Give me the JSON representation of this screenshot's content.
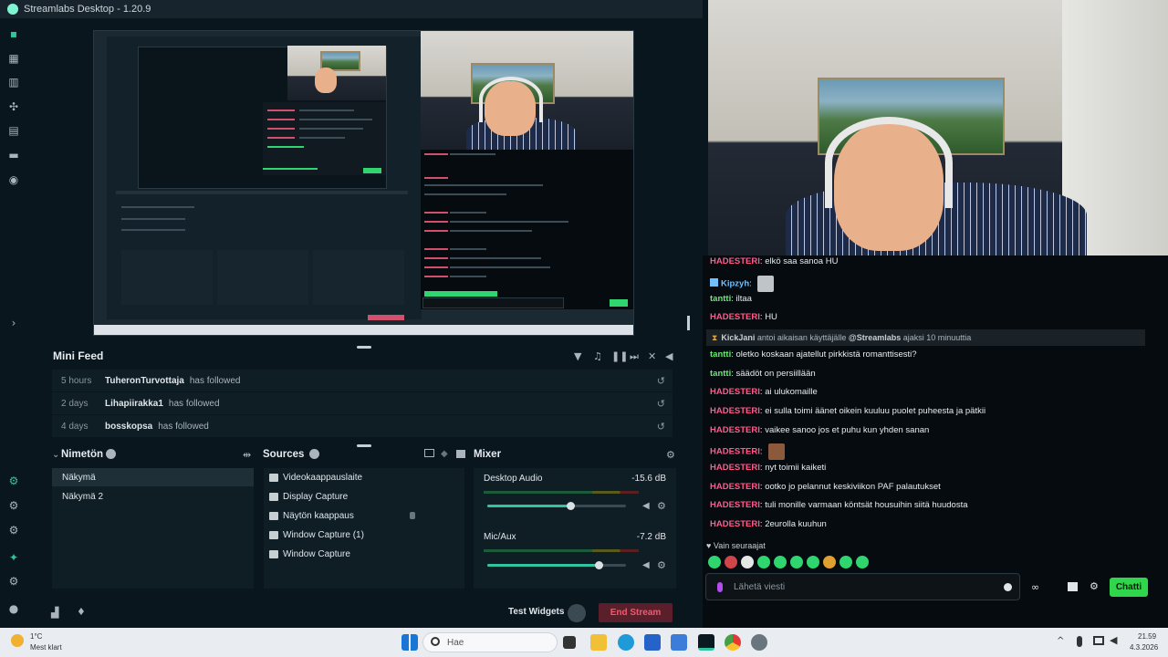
{
  "app": {
    "title": "Streamlabs Desktop - 1.20.9"
  },
  "minifeed": {
    "title": "Mini Feed",
    "items": [
      {
        "time": "5 hours",
        "name": "TuheronTurvottaja",
        "action": "has followed"
      },
      {
        "time": "2 days",
        "name": "Lihapiirakka1",
        "action": "has followed"
      },
      {
        "time": "4 days",
        "name": "bosskopsa",
        "action": "has followed"
      }
    ]
  },
  "scenes": {
    "title": "Nimetön",
    "items": [
      "Näkymä",
      "Näkymä 2"
    ]
  },
  "sources": {
    "title": "Sources",
    "items": [
      "Videokaappauslaite",
      "Display Capture",
      "Näytön kaappaus",
      "Window Capture (1)",
      "Window Capture"
    ]
  },
  "mixer": {
    "title": "Mixer",
    "channels": [
      {
        "name": "Desktop Audio",
        "db": "-15.6 dB",
        "level": 0.6
      },
      {
        "name": "Mic/Aux",
        "db": "-7.2 dB",
        "level": 0.8
      }
    ]
  },
  "footer": {
    "test_widgets": "Test Widgets",
    "end_stream": "End Stream"
  },
  "chat": {
    "messages": [
      {
        "user": "HADESTERI",
        "text": "elkö saa sanoa HU",
        "cls": "hade"
      },
      {
        "user": "Kipzyh",
        "text": "",
        "cls": "kip",
        "emote": true
      },
      {
        "user": "tantti",
        "text": "iltaa",
        "cls": "tan"
      },
      {
        "user": "HADESTERI",
        "text": "HU",
        "cls": "hade"
      },
      {
        "user": "tantti",
        "text": "oletko koskaan ajatellut pirkkistä romanttisesti?",
        "cls": "tan"
      },
      {
        "user": "tantti",
        "text": "säädöt on persiillään",
        "cls": "tan"
      },
      {
        "user": "HADESTERI",
        "text": "ai ulukomaille",
        "cls": "hade"
      },
      {
        "user": "HADESTERI",
        "text": "ei sulla toimi äänet oikein kuuluu puolet puheesta ja pätkii",
        "cls": "hade"
      },
      {
        "user": "HADESTERI",
        "text": "vaikee sanoo jos et puhu kun yhden sanan",
        "cls": "hade"
      },
      {
        "user": "HADESTERI",
        "text": "",
        "cls": "hade",
        "emote": true
      },
      {
        "user": "HADESTERI",
        "text": "nyt toimii kaiketi",
        "cls": "hade"
      },
      {
        "user": "HADESTERI",
        "text": "ootko jo pelannut keskiviikon PAF palautukset",
        "cls": "hade"
      },
      {
        "user": "HADESTERI",
        "text": "tuli monille varmaan köntsät housuihin siitä huudosta",
        "cls": "hade"
      },
      {
        "user": "HADESTERI",
        "text": "2eurolla kuuhun",
        "cls": "hade"
      }
    ],
    "gift": {
      "user": "KickJani",
      "text": " antoi aikaisan käyttäjälle ",
      "target": "@Streamlabs",
      "rest": " ajaksi 10 minuuttia"
    },
    "followers_only": "Vain seuraajat",
    "input_placeholder": "Lähetä viesti",
    "send_label": "Chatti"
  },
  "taskbar": {
    "weather_temp": "1°C",
    "weather_text": "Mest klart",
    "search_placeholder": "Hae",
    "time": "21.59",
    "date": "4.3.2026"
  },
  "colors": {
    "accent": "#31c3a2",
    "chat_button": "#2fd54a",
    "hade": "#ff5a8a",
    "tantti": "#5ff06a",
    "kipzyh": "#6ec0ff"
  }
}
